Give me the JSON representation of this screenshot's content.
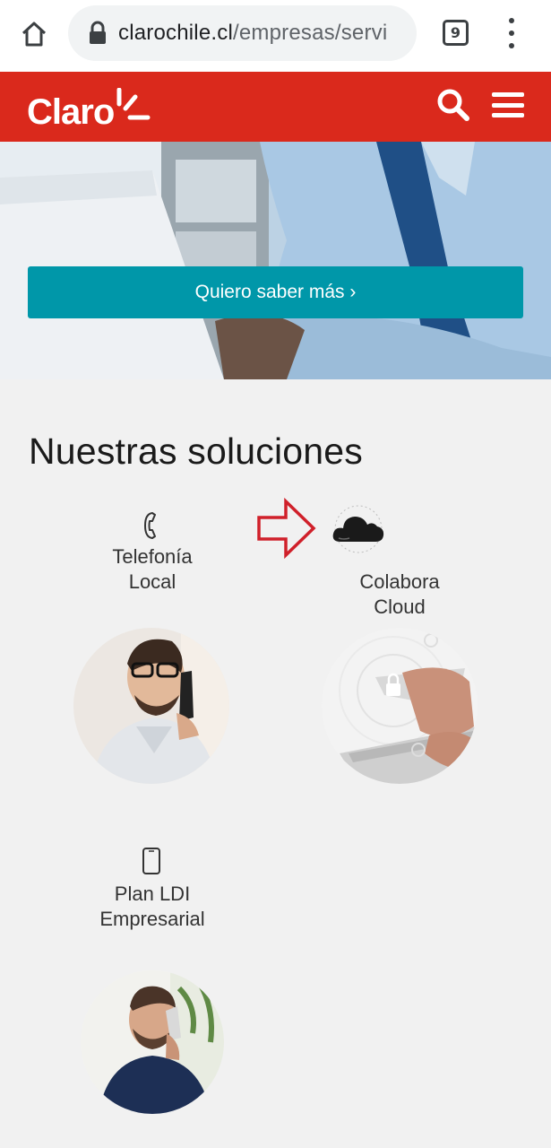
{
  "browser": {
    "url_host": "clarochile.cl",
    "url_path": "/empresas/servi",
    "tab_count": "9",
    "icons": [
      "home-icon",
      "lock-icon",
      "tabs-icon",
      "more-vert-icon"
    ]
  },
  "header": {
    "logo_text": "Claro",
    "icons": [
      "search-icon",
      "menu-icon"
    ],
    "brand_color": "#da291c"
  },
  "hero": {
    "cta_label": "Quiero saber más ›",
    "cta_color": "#0097a9"
  },
  "solutions": {
    "title": "Nuestras soluciones",
    "items": [
      {
        "line1": "Telefonía",
        "line2": "Local",
        "icon": "phone-handset-icon"
      },
      {
        "line1": "Colabora",
        "line2": "Cloud",
        "icon": "cloud-icon"
      },
      {
        "line1": "Plan LDI",
        "line2": "Empresarial",
        "icon": "mobile-phone-icon"
      }
    ]
  },
  "annotation": {
    "icon": "arrow-right-outline-icon",
    "color": "#d0202a"
  }
}
